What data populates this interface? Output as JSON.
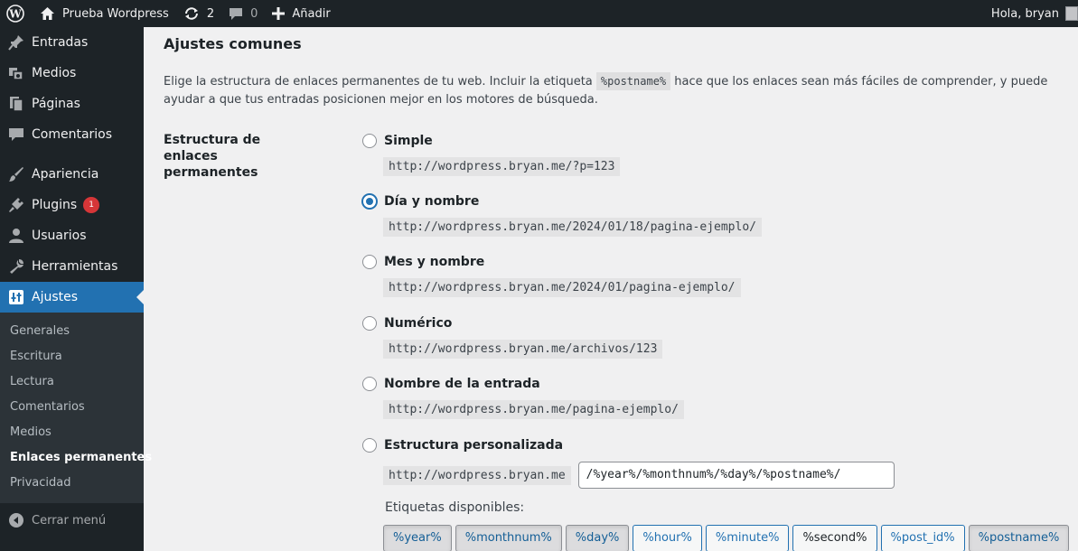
{
  "adminbar": {
    "site_name": "Prueba Wordpress",
    "updates_count": "2",
    "comments_count": "0",
    "new_label": "Añadir",
    "greeting": "Hola, bryan"
  },
  "sidebar": {
    "items": [
      {
        "label": "Entradas",
        "icon": "pushpin-icon"
      },
      {
        "label": "Medios",
        "icon": "media-icon"
      },
      {
        "label": "Páginas",
        "icon": "page-icon"
      },
      {
        "label": "Comentarios",
        "icon": "comment-icon"
      },
      {
        "label": "Apariencia",
        "icon": "brush-icon"
      },
      {
        "label": "Plugins",
        "icon": "plugin-icon",
        "badge": "1"
      },
      {
        "label": "Usuarios",
        "icon": "user-icon"
      },
      {
        "label": "Herramientas",
        "icon": "wrench-icon"
      },
      {
        "label": "Ajustes",
        "icon": "settings-icon",
        "active": true
      }
    ],
    "submenu": [
      "Generales",
      "Escritura",
      "Lectura",
      "Comentarios",
      "Medios",
      "Enlaces permanentes",
      "Privacidad"
    ],
    "current_submenu": "Enlaces permanentes",
    "collapse_label": "Cerrar menú"
  },
  "main": {
    "section_title": "Ajustes comunes",
    "intro_before": "Elige la estructura de enlaces permanentes de tu web. Incluir la etiqueta",
    "intro_tag": "%postname%",
    "intro_after": "hace que los enlaces sean más fáciles de comprender, y puede ayudar a que tus entradas posicionen mejor en los motores de búsqueda.",
    "row_label": "Estructura de enlaces permanentes",
    "options": [
      {
        "label": "Simple",
        "url": "http://wordpress.bryan.me/?p=123",
        "checked": false
      },
      {
        "label": "Día y nombre",
        "url": "http://wordpress.bryan.me/2024/01/18/pagina-ejemplo/",
        "checked": true
      },
      {
        "label": "Mes y nombre",
        "url": "http://wordpress.bryan.me/2024/01/pagina-ejemplo/",
        "checked": false
      },
      {
        "label": "Numérico",
        "url": "http://wordpress.bryan.me/archivos/123",
        "checked": false
      },
      {
        "label": "Nombre de la entrada",
        "url": "http://wordpress.bryan.me/pagina-ejemplo/",
        "checked": false
      }
    ],
    "custom": {
      "label": "Estructura personalizada",
      "base_url": "http://wordpress.bryan.me",
      "value": "/%year%/%monthnum%/%day%/%postname%/",
      "available_label": "Etiquetas disponibles:",
      "tags": [
        {
          "label": "%year%",
          "pressed": true
        },
        {
          "label": "%monthnum%",
          "pressed": true
        },
        {
          "label": "%day%",
          "pressed": true
        },
        {
          "label": "%hour%",
          "pressed": false
        },
        {
          "label": "%minute%",
          "pressed": false
        },
        {
          "label": "%second%",
          "pressed": false
        },
        {
          "label": "%post_id%",
          "pressed": false
        },
        {
          "label": "%postname%",
          "pressed": true
        }
      ]
    }
  }
}
